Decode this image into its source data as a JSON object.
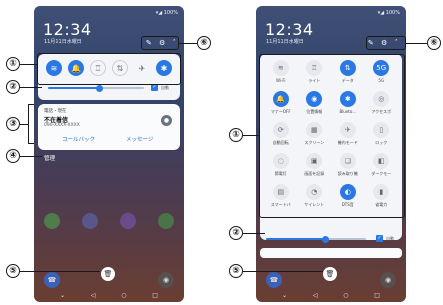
{
  "callouts": {
    "c1": "①",
    "c2": "②",
    "c3": "③",
    "c4": "④",
    "c5": "⑤",
    "c6": "⑥"
  },
  "status": {
    "time": "12:34",
    "date": "11月11日水曜日",
    "right_indicators": "▾◢ 100%"
  },
  "header_icons": {
    "edit": "✎",
    "settings": "⚙",
    "collapse": "ˆ"
  },
  "quick_tiles_left": [
    {
      "icon": "wifi-icon",
      "glyph": "≋",
      "state": "on"
    },
    {
      "icon": "notifications-icon",
      "glyph": "🔔",
      "state": "on"
    },
    {
      "icon": "flashlight-icon",
      "glyph": "♖",
      "state": "dim"
    },
    {
      "icon": "mobile-data-icon",
      "glyph": "⇅",
      "state": "dim"
    },
    {
      "icon": "airplane-icon",
      "glyph": "✈",
      "state": "off"
    },
    {
      "icon": "bluetooth-icon",
      "glyph": "✱",
      "state": "on"
    }
  ],
  "brightness": {
    "auto_label": "自動",
    "level": 0.55
  },
  "notification": {
    "header": "電話・現在",
    "title": "不在着信",
    "number": "090-XXXX-XXXX",
    "actions": [
      "コールバック",
      "メッセージ"
    ]
  },
  "manage_label": "管理",
  "trash_glyph": "🗑",
  "nav": [
    "⌄",
    "◁",
    "○",
    "□"
  ],
  "expanded_tiles": [
    {
      "label": "Wi-Fi",
      "glyph": "≋",
      "state": "off"
    },
    {
      "label": "ライト",
      "glyph": "♖",
      "state": "off"
    },
    {
      "label": "データ",
      "glyph": "⇅",
      "state": "on"
    },
    {
      "label": "5G",
      "glyph": "5G",
      "state": "on"
    },
    {
      "label": "マナーOFF",
      "glyph": "🔔",
      "state": "on"
    },
    {
      "label": "位置情報",
      "glyph": "◉",
      "state": "on"
    },
    {
      "label": "Blueto...",
      "glyph": "✱",
      "state": "on"
    },
    {
      "label": "アクセスポ",
      "glyph": "◎",
      "state": "off"
    },
    {
      "label": "自動回転",
      "glyph": "⟳",
      "state": "off"
    },
    {
      "label": "スクリーン",
      "glyph": "▦",
      "state": "off"
    },
    {
      "label": "機内モード",
      "glyph": "✈",
      "state": "off"
    },
    {
      "label": "ロック",
      "glyph": "▯",
      "state": "off"
    },
    {
      "label": "節電灯",
      "glyph": "◌",
      "state": "off"
    },
    {
      "label": "画面を記録",
      "glyph": "▣",
      "state": "off"
    },
    {
      "label": "読み取り機",
      "glyph": "❏",
      "state": "off"
    },
    {
      "label": "ダークモー",
      "glyph": "◧",
      "state": "off"
    },
    {
      "label": "スマートバ",
      "glyph": "▤",
      "state": "off"
    },
    {
      "label": "サイレント",
      "glyph": "◔",
      "state": "off"
    },
    {
      "label": "DTS音",
      "glyph": "◐",
      "state": "on"
    },
    {
      "label": "省電力",
      "glyph": "▮",
      "state": "off"
    }
  ]
}
